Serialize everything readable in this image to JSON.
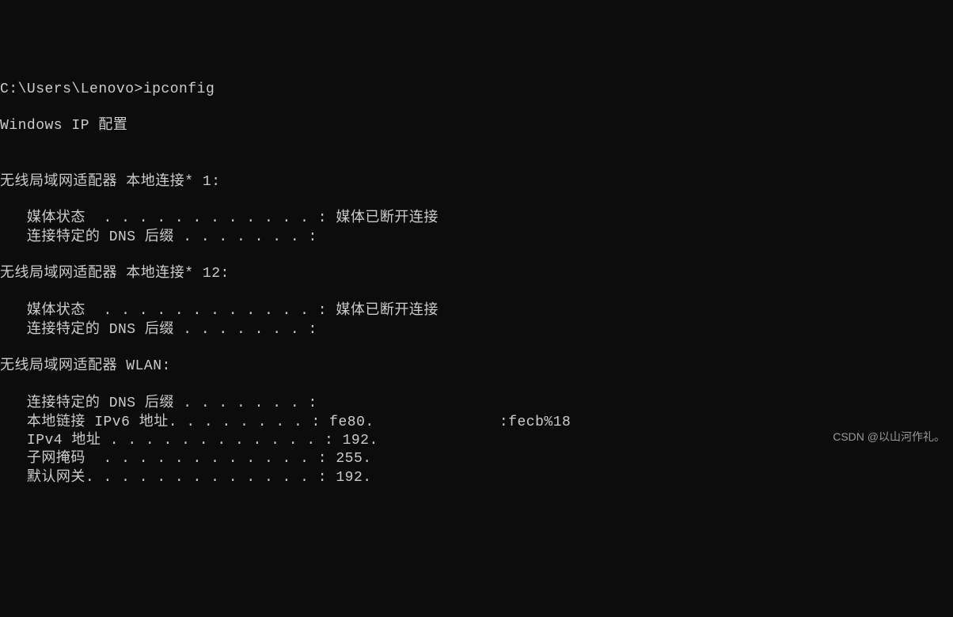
{
  "terminal": {
    "prompt": "C:\\Users\\Lenovo>",
    "command": "ipconfig",
    "header": "Windows IP 配置",
    "adapters": [
      {
        "title": "无线局域网适配器 本地连接* 1:",
        "lines": [
          {
            "label": "   媒体状态  . . . . . . . . . . . . :",
            "value": " 媒体已断开连接"
          },
          {
            "label": "   连接特定的 DNS 后缀 . . . . . . . :",
            "value": ""
          }
        ]
      },
      {
        "title": "无线局域网适配器 本地连接* 12:",
        "lines": [
          {
            "label": "   媒体状态  . . . . . . . . . . . . :",
            "value": " 媒体已断开连接"
          },
          {
            "label": "   连接特定的 DNS 后缀 . . . . . . . :",
            "value": ""
          }
        ]
      },
      {
        "title": "无线局域网适配器 WLAN:",
        "lines": [
          {
            "label": "   连接特定的 DNS 后缀 . . . . . . . :",
            "value": ""
          },
          {
            "label": "   本地链接 IPv6 地址. . . . . . . . :",
            "value": " fe80.              :fecb%18"
          },
          {
            "label": "   IPv4 地址 . . . . . . . . . . . . :",
            "value": " 192."
          },
          {
            "label": "   子网掩码  . . . . . . . . . . . . :",
            "value": " 255."
          },
          {
            "label": "   默认网关. . . . . . . . . . . . . :",
            "value": " 192."
          }
        ]
      }
    ]
  },
  "watermark": "CSDN @以山河作礼。"
}
